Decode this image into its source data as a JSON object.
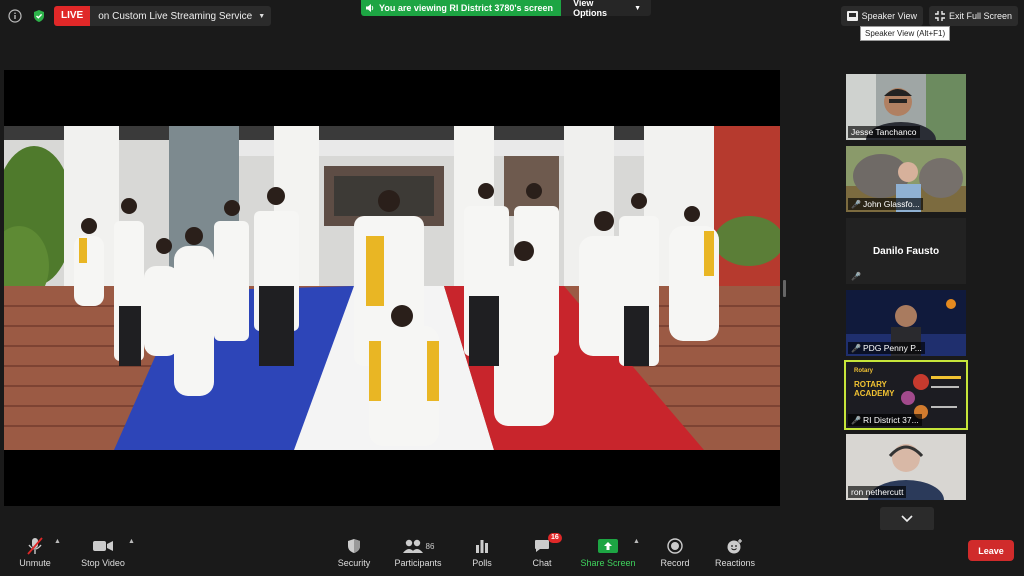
{
  "top_bar": {
    "live_badge": "LIVE",
    "live_destination": "on Custom Live Streaming Service",
    "viewing_banner": "You are viewing RI District 3780's screen",
    "view_options": "View Options",
    "speaker_view": "Speaker View",
    "exit_full_screen": "Exit Full Screen",
    "tooltip": "Speaker View (Alt+F1)"
  },
  "participants": [
    {
      "name": "Jesse Tanchanco",
      "muted": false
    },
    {
      "name": "John Glassfo...",
      "muted": true
    },
    {
      "name": "Danilo Fausto",
      "muted": true
    },
    {
      "name": "PDG Penny P...",
      "muted": true
    },
    {
      "name": "RI District 37...",
      "muted": true,
      "active": true
    },
    {
      "name": "ron nethercutt",
      "muted": false
    }
  ],
  "tile_texts": {
    "rotary_academy": "ROTARY ACADEMY",
    "rotary": "Rotary"
  },
  "toolbar": {
    "unmute": "Unmute",
    "stop_video": "Stop Video",
    "security": "Security",
    "participants": "Participants",
    "participants_count": "86",
    "polls": "Polls",
    "chat": "Chat",
    "chat_badge": "16",
    "share_screen": "Share Screen",
    "record": "Record",
    "reactions": "Reactions",
    "leave": "Leave"
  },
  "colors": {
    "live_red": "#e02828",
    "share_green": "#1da543",
    "active_border": "#c6e53a",
    "leave_red": "#d02b2b"
  }
}
